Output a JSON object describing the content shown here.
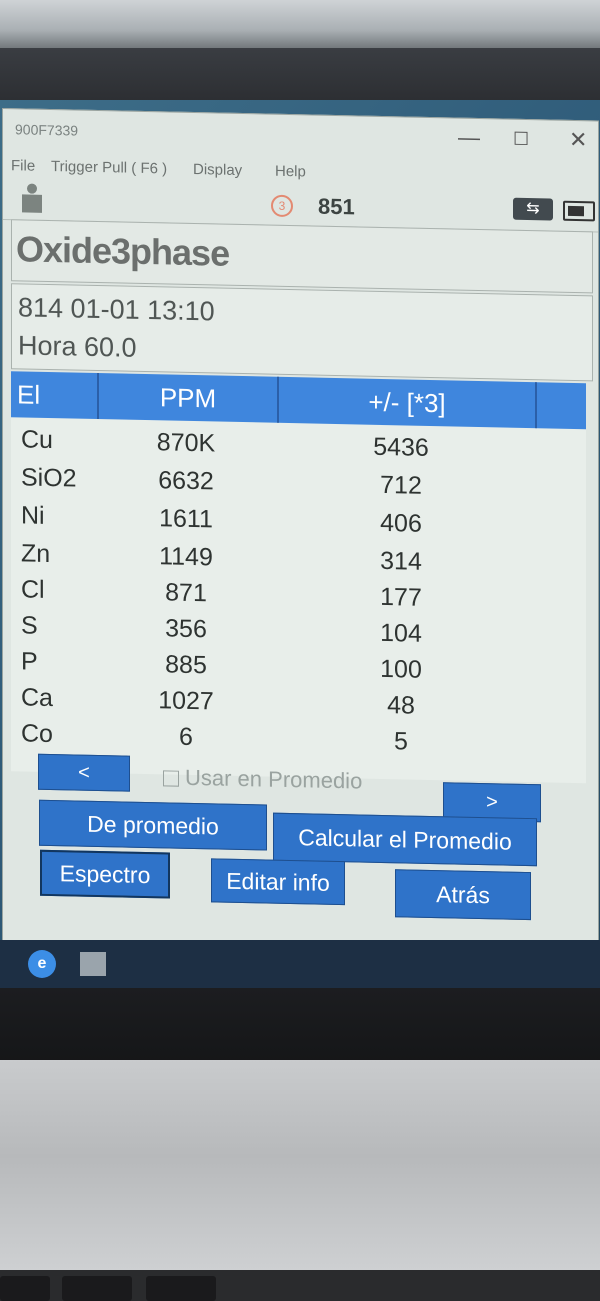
{
  "window": {
    "title": "900F7339",
    "controls": {
      "minimize": "—",
      "maximize": "☐",
      "close": "✕"
    }
  },
  "menu": [
    "File",
    "Trigger Pull ( F6 )",
    "Display",
    "Help"
  ],
  "toolbar": {
    "badge": "3",
    "count": "851"
  },
  "heading": "Oxide3phase",
  "info": {
    "line1": "814 01-01 13:10",
    "line2": "Hora 60.0"
  },
  "table": {
    "columns": [
      "El",
      "PPM",
      "+/- [*3]"
    ],
    "rows": [
      {
        "el": "Cu",
        "ppm": "870K",
        "err": "5436"
      },
      {
        "el": "SiO2",
        "ppm": "6632",
        "err": "712"
      },
      {
        "el": "Ni",
        "ppm": "1611",
        "err": "406"
      },
      {
        "el": "Zn",
        "ppm": "1149",
        "err": "314"
      },
      {
        "el": "Cl",
        "ppm": "871",
        "err": "177"
      },
      {
        "el": "S",
        "ppm": "356",
        "err": "104"
      },
      {
        "el": "P",
        "ppm": "885",
        "err": "100"
      },
      {
        "el": "Ca",
        "ppm": "1027",
        "err": "48"
      },
      {
        "el": "Co",
        "ppm": "6",
        "err": "5"
      }
    ]
  },
  "controls": {
    "prev": "<",
    "next": ">",
    "checkbox_label": "Usar en Promedio",
    "checkbox_checked": false
  },
  "buttons": {
    "de_promedio": "De promedio",
    "calcular": "Calcular el Promedio",
    "espectro": "Espectro",
    "editar": "Editar info",
    "atras": "Atrás"
  },
  "colors": {
    "header_blue": "#3f86dd",
    "button_blue": "#2f73c9"
  }
}
